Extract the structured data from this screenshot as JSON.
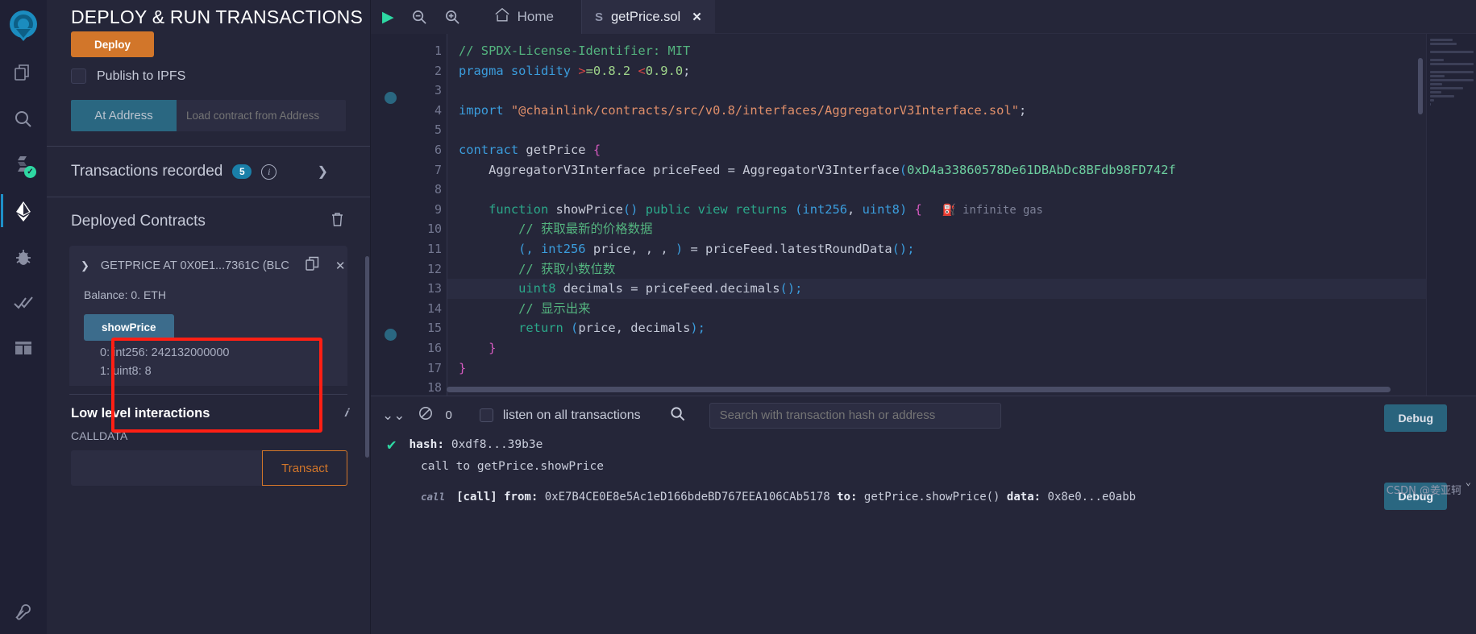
{
  "iconbar": {
    "items": [
      {
        "name": "remix-logo",
        "label": "Remix"
      },
      {
        "name": "file-explorer-icon",
        "label": "File explorer"
      },
      {
        "name": "search-icon",
        "label": "Search in files"
      },
      {
        "name": "solidity-compiler-icon",
        "label": "Solidity compiler"
      },
      {
        "name": "deploy-run-icon",
        "label": "Deploy & run transactions"
      },
      {
        "name": "debugger-icon",
        "label": "Debugger"
      },
      {
        "name": "solidity-analyzer-icon",
        "label": "Solidity analyzers"
      },
      {
        "name": "plugin-manager-icon",
        "label": "Plugin manager"
      },
      {
        "name": "settings-icon",
        "label": "Settings"
      }
    ]
  },
  "left_panel": {
    "title": "DEPLOY & RUN TRANSACTIONS",
    "deploy_label": "Deploy",
    "publish_ipfs_label": "Publish to IPFS",
    "at_address_label": "At Address",
    "at_address_placeholder": "Load contract from Address",
    "transactions_recorded_label": "Transactions recorded",
    "transactions_recorded_count": "5",
    "deployed_contracts_label": "Deployed Contracts",
    "contract": {
      "name": "GETPRICE AT 0X0E1...7361C (BLC",
      "balance": "Balance: 0. ETH",
      "function_button": "showPrice",
      "returns": [
        "0: int256: 242132000000",
        "1: uint8: 8"
      ]
    },
    "low_level_interactions_label": "Low level interactions",
    "calldata_label": "CALLDATA",
    "calldata_value": "",
    "transact_label": "Transact"
  },
  "toolbar": {
    "run_label": "run",
    "zoom_out_label": "zoom out",
    "zoom_in_label": "zoom in",
    "home_label": "Home"
  },
  "tabs": [
    {
      "label": "getPrice.sol",
      "active": true
    }
  ],
  "editor": {
    "gas_hint": "infinite gas",
    "lines": [
      {
        "n": "1",
        "html": "<span class='tk-com'>// SPDX-License-Identifier: MIT</span>"
      },
      {
        "n": "2",
        "html": "<span class='tk-kw'>pragma</span> <span class='tk-kw'>solidity</span> <span class='tk-op'>&gt;</span><span class='tk-num'>=0.8.2</span> <span class='tk-op'>&lt;</span><span class='tk-num'>0.9.0</span><span class='tk-id'>;</span>"
      },
      {
        "n": "3",
        "html": ""
      },
      {
        "n": "4",
        "html": "<span class='tk-kw'>import</span> <span class='tk-str'>\"@chainlink/contracts/src/v0.8/interfaces/AggregatorV3Interface.sol\"</span><span class='tk-id'>;</span>"
      },
      {
        "n": "5",
        "html": ""
      },
      {
        "n": "6",
        "html": "<span class='tk-kw'>contract</span> <span class='tk-fn'>getPrice</span> <span class='tk-brace'>{</span>"
      },
      {
        "n": "7",
        "html": "    <span class='tk-fn'>AggregatorV3Interface</span> <span class='tk-id'>priceFeed</span> <span class='tk-id'>=</span> <span class='tk-fn'>AggregatorV3Interface</span><span class='tk-kw'>(</span><span class='tk-addr'>0xD4a33860578De61DBAbDc8BFdb98FD742f</span>"
      },
      {
        "n": "8",
        "html": ""
      },
      {
        "n": "9",
        "html": "    <span class='tk-kw2'>function</span> <span class='tk-fn'>showPrice</span><span class='tk-kw'>()</span> <span class='tk-kw2'>public</span> <span class='tk-kw2'>view</span> <span class='tk-kw2'>returns</span> <span class='tk-kw'>(</span><span class='tk-kw'>int256</span><span class='tk-id'>,</span> <span class='tk-kw'>uint8</span><span class='tk-kw'>)</span> <span class='tk-brace'>{</span>"
      },
      {
        "n": "10",
        "html": "        <span class='tk-com'>// 获取最新的价格数据</span>"
      },
      {
        "n": "11",
        "html": "        <span class='tk-kw'>(,</span> <span class='tk-kw'>int256</span> <span class='tk-id'>price,</span> <span class='tk-id'>,</span> <span class='tk-id'>,</span> <span class='tk-kw'>)</span> <span class='tk-id'>=</span> <span class='tk-id'>priceFeed.latestRoundData</span><span class='tk-kw'>();</span>"
      },
      {
        "n": "12",
        "html": "        <span class='tk-com'>// 获取小数位数</span>"
      },
      {
        "n": "13",
        "html": "        <span class='tk-kw2'>uint8</span> <span class='tk-id'>decimals</span> <span class='tk-id'>=</span> <span class='tk-id'>priceFeed.decimals</span><span class='tk-kw'>();</span>",
        "hl": true
      },
      {
        "n": "14",
        "html": "        <span class='tk-com'>// 显示出来</span>"
      },
      {
        "n": "15",
        "html": "        <span class='tk-kw2'>return</span> <span class='tk-kw'>(</span><span class='tk-id'>price,</span> <span class='tk-id'>decimals</span><span class='tk-kw'>);</span>"
      },
      {
        "n": "16",
        "html": "    <span class='tk-brace'>}</span>"
      },
      {
        "n": "17",
        "html": "<span class='tk-brace'>}</span>"
      },
      {
        "n": "18",
        "html": ""
      }
    ]
  },
  "terminal": {
    "error_count": "0",
    "listen_label": "listen on all transactions",
    "search_placeholder": "Search with transaction hash or address",
    "log": {
      "hash_label": "hash:",
      "hash_value": "0xdf8...39b3e",
      "call_line": "call to getPrice.showPrice",
      "call_tag": "call",
      "detail_prefix": "[call]",
      "from_label": "from:",
      "from_value": "0xE7B4CE0E8e5Ac1eD166bdeBD767EEA106CAb5178",
      "to_label": "to:",
      "to_value": "getPrice.showPrice()",
      "data_label": "data:",
      "data_value": "0x8e0...e0abb",
      "debug_label": "Debug"
    }
  },
  "watermark": "CSDN @姜亚轲"
}
